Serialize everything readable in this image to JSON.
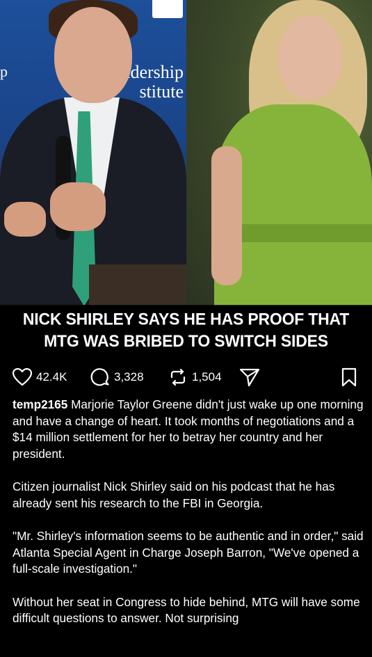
{
  "media": {
    "sign_text": "adership\nstitute",
    "sign_letter": "p",
    "caption_line1": "NICK SHIRLEY SAYS HE HAS PROOF THAT",
    "caption_line2": "MTG WAS BRIBED TO SWITCH SIDES"
  },
  "actions": {
    "likes": "42.4K",
    "comments": "3,328",
    "reposts": "1,504",
    "icons": [
      "heart-icon",
      "comment-icon",
      "repost-icon",
      "share-icon",
      "bookmark-icon"
    ]
  },
  "post": {
    "username": "temp2165",
    "paragraph1": "Marjorie Taylor Greene didn't just wake up one morning and have a change of heart. It took months of negotiations and a $14 million settlement for her to betray her country and her president.",
    "paragraph2": "Citizen journalist Nick Shirley said on his podcast that he has already sent his research to the FBI in Georgia.",
    "paragraph3": "\"Mr. Shirley's information seems to be authentic and in order,\" said Atlanta Special Agent in Charge Joseph Barron, \"We've opened a full-scale investigation.\"",
    "paragraph4": "Without her seat in Congress to hide behind, MTG will have some difficult questions to answer. Not surprising"
  },
  "colors": {
    "background": "#000000",
    "text": "#ffffff",
    "tie": "#2fa07a",
    "dress": "#86b43a"
  }
}
